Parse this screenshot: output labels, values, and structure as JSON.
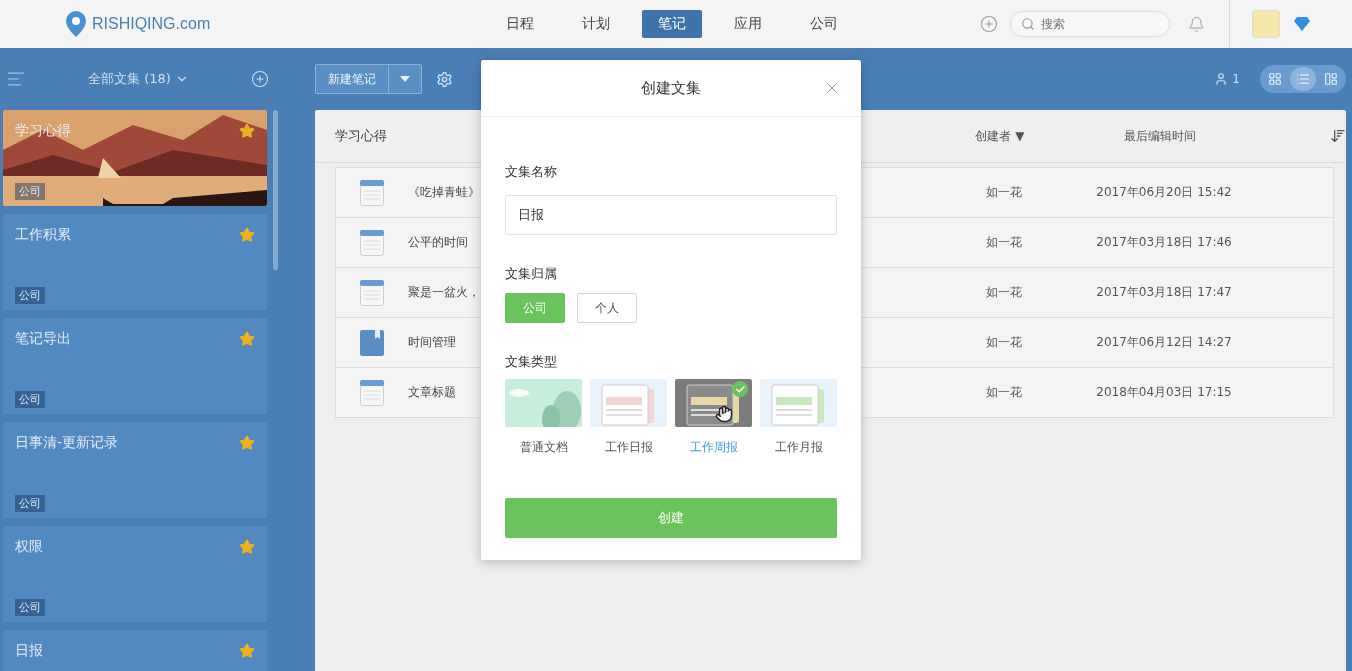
{
  "header": {
    "logo": "RISHIQING.com",
    "nav": [
      {
        "label": "日程",
        "selected": false
      },
      {
        "label": "计划",
        "selected": false
      },
      {
        "label": "笔记",
        "selected": true
      },
      {
        "label": "应用",
        "selected": false
      },
      {
        "label": "公司",
        "selected": false
      }
    ],
    "search": {
      "placeholder": "搜索"
    }
  },
  "sidebar": {
    "title": "全部文集 (18)",
    "collections": [
      {
        "name": "学习心得",
        "tag": "公司",
        "starred": true,
        "kind": "cover"
      },
      {
        "name": "工作积累",
        "tag": "公司",
        "starred": true,
        "kind": "plain"
      },
      {
        "name": "笔记导出",
        "tag": "公司",
        "starred": true,
        "kind": "plain"
      },
      {
        "name": "日事清-更新记录",
        "tag": "公司",
        "starred": true,
        "kind": "plain"
      },
      {
        "name": "权限",
        "tag": "公司",
        "starred": true,
        "kind": "plain"
      },
      {
        "name": "日报",
        "starred": true,
        "kind": "plain"
      }
    ]
  },
  "toolbar": {
    "new_button": "新建笔记",
    "member_count": "1",
    "views": [
      {
        "selected": false
      },
      {
        "selected": true
      },
      {
        "selected": false
      }
    ]
  },
  "table": {
    "title": "学习心得",
    "columns": [
      "创建者 ▼",
      "最后编辑时间"
    ],
    "rows": [
      {
        "title": "《吃掉青蛙》",
        "kind": "note",
        "creator": "如一花",
        "edited": "2017年06月20日 15:42"
      },
      {
        "title": "公平的时间",
        "kind": "note",
        "creator": "如一花",
        "edited": "2017年03月18日 17:46"
      },
      {
        "title": "聚是一盆火，",
        "kind": "note",
        "creator": "如一花",
        "edited": "2017年03月18日 17:47"
      },
      {
        "title": "时间管理",
        "kind": "book",
        "creator": "如一花",
        "edited": "2017年06月12日 14:27"
      },
      {
        "title": "文章标题",
        "kind": "note",
        "creator": "如一花",
        "edited": "2018年04月03日 17:15"
      }
    ]
  },
  "dialog": {
    "title": "创建文集",
    "name_label": "文集名称",
    "name_value": "日报",
    "owner_label": "文集归属",
    "owners": [
      {
        "label": "公司",
        "selected": true
      },
      {
        "label": "个人",
        "selected": false
      }
    ],
    "type_label": "文集类型",
    "types": [
      {
        "label": "普通文档",
        "kind": "landscape",
        "selected": false
      },
      {
        "label": "工作日报",
        "kind": "articles",
        "color": "#f4d4d6",
        "selected": false
      },
      {
        "label": "工作周报",
        "kind": "articles",
        "color": "#e8d8a8",
        "selected": true
      },
      {
        "label": "工作月报",
        "kind": "articles",
        "color": "#c9e8c0",
        "selected": false
      }
    ],
    "submit": "创建"
  }
}
